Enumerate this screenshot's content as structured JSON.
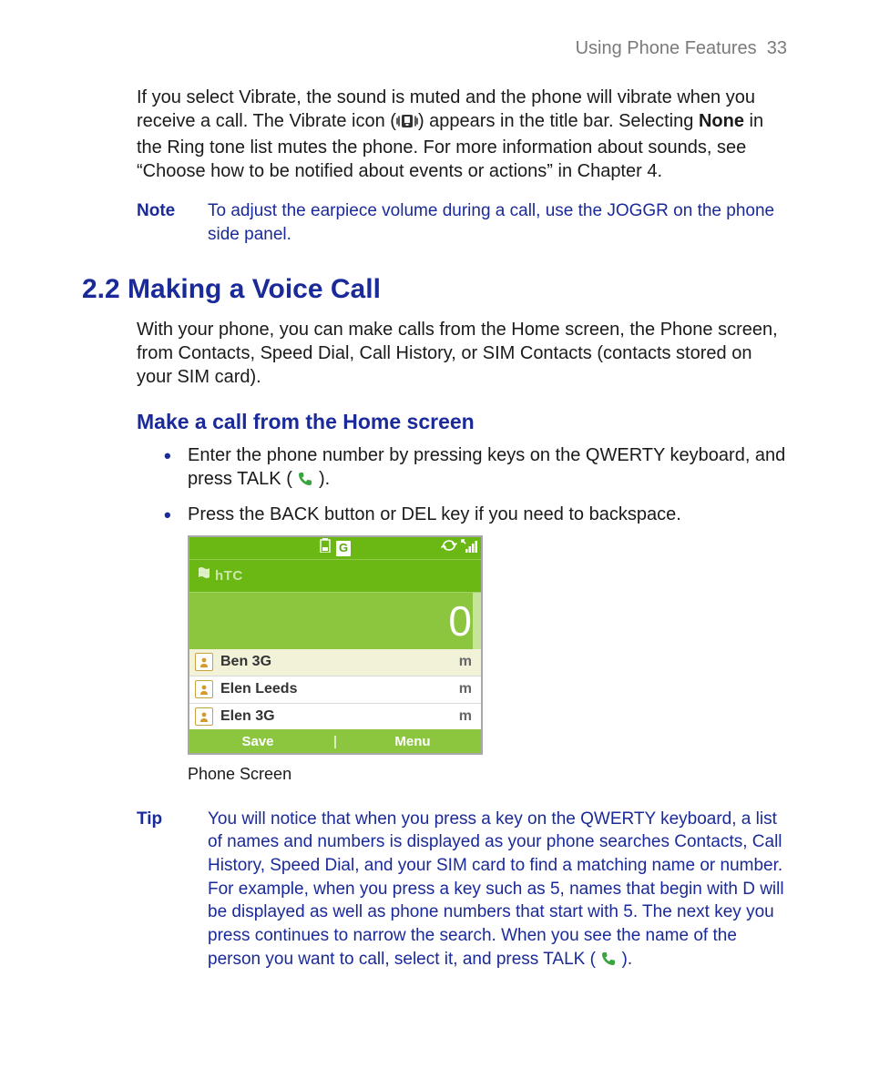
{
  "header": {
    "chapter": "Using Phone Features",
    "page": "33"
  },
  "intro": {
    "p1a": "If you select Vibrate, the sound is muted and the phone will vibrate when you receive a call. The Vibrate icon (",
    "p1b": ") appears in the title bar. Selecting ",
    "none": "None",
    "p1c": " in the Ring tone list mutes the phone. For more information about sounds, see “Choose how to be notified about events or actions” in Chapter 4."
  },
  "note": {
    "label": "Note",
    "body": "To adjust the earpiece volume during a call, use the JOGGR on the phone side panel."
  },
  "section": {
    "heading": "2.2 Making a Voice Call",
    "body": "With your phone, you can make calls from the Home screen, the Phone screen, from Contacts, Speed Dial, Call History, or SIM Contacts (contacts stored on your SIM card)."
  },
  "sub": {
    "heading": "Make a call from the Home screen",
    "b1a": "Enter the phone number by pressing keys on the QWERTY keyboard, and press TALK ( ",
    "b1b": " ).",
    "b2": "Press the BACK button or DEL key if you need to backspace."
  },
  "phone_screen": {
    "status_icons": {
      "batt": "batt-icon",
      "g": "G",
      "sync": "sync-icon",
      "signal": "signal-icon"
    },
    "brand": "hTC",
    "dialed": "0",
    "contacts": [
      {
        "name": "Ben 3G",
        "tag": "m",
        "hl": true
      },
      {
        "name": "Elen  Leeds",
        "tag": "m",
        "hl": false
      },
      {
        "name": "Elen 3G",
        "tag": "m",
        "hl": false
      }
    ],
    "softkeys": {
      "left": "Save",
      "right": "Menu"
    }
  },
  "caption": "Phone Screen",
  "tip": {
    "label": "Tip",
    "body_a": "You will notice that when you press a key on the QWERTY keyboard, a list of names and numbers is displayed as your phone searches Contacts, Call History, Speed Dial, and your SIM card to find a matching name or number. For example, when you press a key such as 5, names that begin with D will be displayed as well as phone numbers that start with 5. The next key you press continues to narrow the search. When you see the name of the person you want to call, select it, and press TALK ( ",
    "body_b": " )."
  }
}
